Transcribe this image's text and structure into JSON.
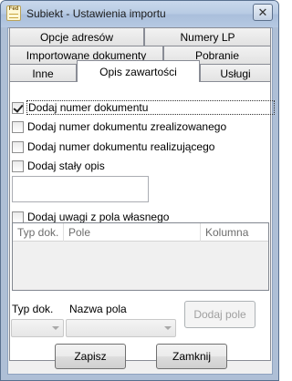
{
  "window": {
    "title": "Subiekt - Ustawienia importu",
    "icon_text": "Fed"
  },
  "tabs": {
    "row1": [
      "Opcje adresów",
      "Numery LP"
    ],
    "row2": [
      "Importowane dokumenty",
      "Pobranie"
    ],
    "row3": [
      "Inne",
      "Opis zawartości",
      "Usługi"
    ],
    "active": "Opis zawartości"
  },
  "options": [
    {
      "label": "Dodaj numer dokumentu",
      "checked": true
    },
    {
      "label": "Dodaj numer dokumentu zrealizowanego",
      "checked": false
    },
    {
      "label": "Dodaj numer dokumentu realizującego",
      "checked": false
    },
    {
      "label": "Dodaj stały opis",
      "checked": false
    }
  ],
  "custom_fields": {
    "label": "Dodaj uwagi z pola własnego",
    "checked": false,
    "columns": [
      "Typ dok.",
      "Pole",
      "Kolumna"
    ]
  },
  "add_field": {
    "doc_type_label": "Typ dok.",
    "field_name_label": "Nazwa pola",
    "add_button": "Dodaj pole"
  },
  "footer": {
    "save": "Zapisz",
    "close": "Zamknij"
  }
}
